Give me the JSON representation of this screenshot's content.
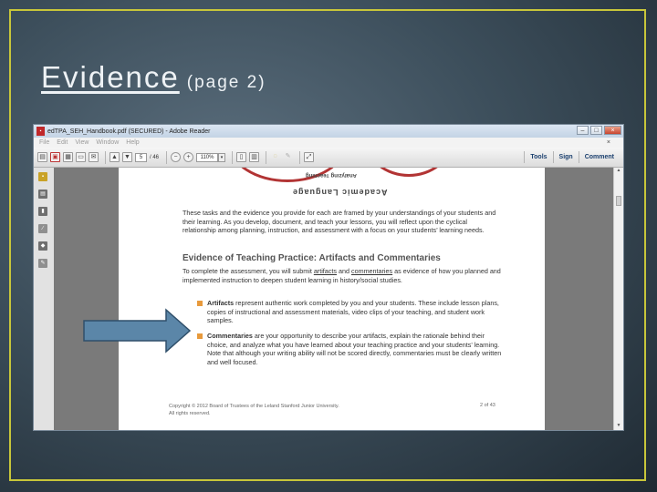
{
  "slide": {
    "title": "Evidence",
    "subtitle": "(page 2)"
  },
  "window": {
    "title": "edTPA_SEH_Handbook.pdf (SECURED) - Adobe Reader",
    "menu": [
      "File",
      "Edit",
      "View",
      "Window",
      "Help"
    ],
    "menu_close": "×",
    "toolbar": {
      "page_current": "5",
      "page_total": "/ 46",
      "zoom": "110%",
      "tabs": [
        "Tools",
        "Sign",
        "Comment"
      ]
    }
  },
  "document": {
    "arc_text_small": "Analyzing Teaching",
    "arc_text_large": "Academic Language",
    "intro": "These tasks and the evidence you provide for each are framed by your understandings of your students and their learning. As you develop, document, and teach your lessons, you will reflect upon the cyclical relationship among planning, instruction, and assessment with a focus on your students’ learning needs.",
    "heading": "Evidence of Teaching Practice: Artifacts and Commentaries",
    "para_part1": "To complete the assessment, you will submit ",
    "para_link1": "artifacts",
    "para_part2": " and ",
    "para_link2": "commentaries",
    "para_part3": " as evidence of how you planned and implemented instruction to deepen student learning in history/social studies.",
    "bullet1_term": "Artifacts",
    "bullet1_text": " represent authentic work completed by you and your students. These include lesson plans, copies of instructional and assessment materials, video clips of your teaching, and student work samples.",
    "bullet2_term": "Commentaries",
    "bullet2_text": " are your opportunity to describe your artifacts, explain the rationale behind their choice, and analyze what you have learned about your teaching practice and your students’ learning. Note that although your writing ability will not be scored directly, commentaries must be clearly written and well focused.",
    "footer_line1": "Copyright © 2012 Board of Trustees of the Leland Stanford Junior University.",
    "footer_line2": "All rights reserved.",
    "footer_page": "2 of 43"
  },
  "colors": {
    "frame": "#c8c63a",
    "arrow_fill": "#5b86a8",
    "bullet": "#e89a3c",
    "logo_circle": "#b23434"
  },
  "icons": [
    "pdf-icon",
    "open-icon",
    "create-pdf-icon",
    "save-icon",
    "print-icon",
    "email-icon",
    "page-up-icon",
    "page-down-icon",
    "zoom-out-icon",
    "zoom-in-icon",
    "fit-page-icon",
    "comment-icon",
    "highlight-icon",
    "expand-icon",
    "lock-icon",
    "pages-icon",
    "bookmark-icon",
    "attachment-icon",
    "layers-icon",
    "signature-icon",
    "right-arrow-icon"
  ]
}
